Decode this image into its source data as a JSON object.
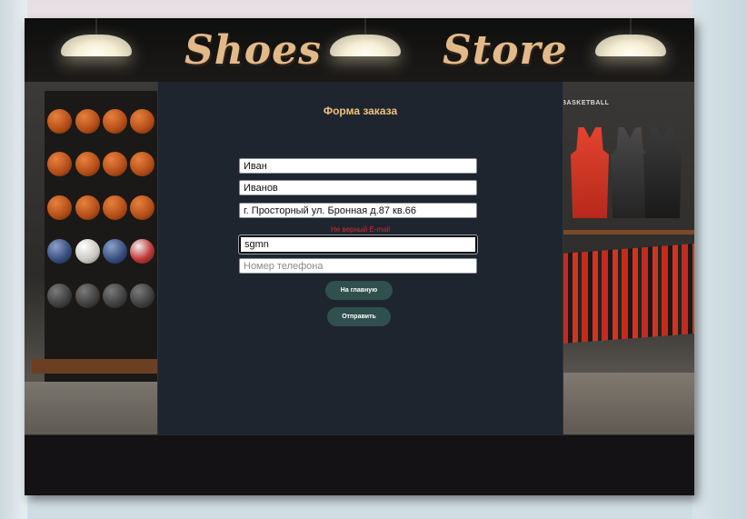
{
  "header": {
    "logo_left": "Shoes",
    "logo_right": "Store"
  },
  "store_left": {
    "description": "basketball rack"
  },
  "store_right": {
    "sign_text": "BASKETBALL"
  },
  "form": {
    "title": "Форма заказа",
    "first_name": {
      "value": "Иван",
      "placeholder": ""
    },
    "last_name": {
      "value": "Иванов",
      "placeholder": ""
    },
    "address": {
      "value": "г. Просторный ул. Бронная д.87 кв.66",
      "placeholder": ""
    },
    "email_error": "Не верный E-mail",
    "email": {
      "value": "sgmn",
      "placeholder": ""
    },
    "phone": {
      "value": "",
      "placeholder": "Номер телефона"
    },
    "home_button": "На главную",
    "submit_button": "Отправить"
  },
  "colors": {
    "accent_title": "#f3c27a",
    "logo": "#e2b98a",
    "button_bg": "#2f504e",
    "error": "#d22a2a",
    "panel_bg": "#1f252f"
  }
}
